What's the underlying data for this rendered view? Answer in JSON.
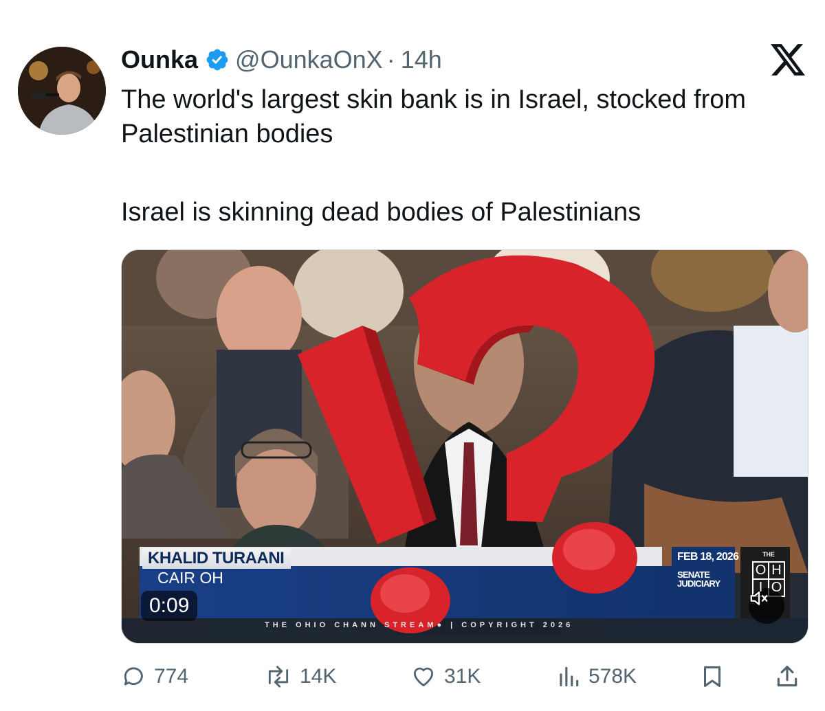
{
  "tweet": {
    "author_name": "Ounka",
    "handle": "@OunkaOnX",
    "separator": "·",
    "time": "14h",
    "text_line1": "The world's largest skin bank is in Israel, stocked from Palestinian bodies",
    "text_line2": "Israel is skinning dead bodies of Palestinians"
  },
  "media": {
    "lower_third_name": "KHALID TURAANI",
    "lower_third_org": "CAIR OH",
    "duration": "0:09",
    "broadcast_date": "FEB 18, 2026",
    "committee": "SENATE JUDICIARY",
    "ticker": "THE OHIO CHANN          STREAM● | COPYRIGHT 2026",
    "logo_top": "THE",
    "logo_letters": [
      "O",
      "H",
      "I",
      "O"
    ],
    "overlay_icon": "interrobang-icon",
    "mute_icon": "volume-muted-icon"
  },
  "actions": {
    "replies": "774",
    "reposts": "14K",
    "likes": "31K",
    "views": "578K"
  },
  "colors": {
    "verified": "#1d9bf0",
    "text": "#0f1419",
    "secondary": "#536471",
    "overlay_red": "#d9232a",
    "lower_third_blue": "#1a3f86"
  }
}
